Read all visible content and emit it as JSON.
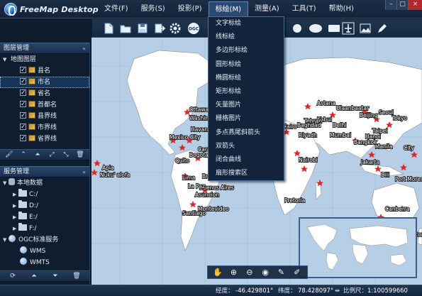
{
  "app": {
    "title": "FreeMap Desktop"
  },
  "menubar": {
    "items": [
      {
        "label": "文件(F)"
      },
      {
        "label": "服务(S)"
      },
      {
        "label": "投影(P)"
      },
      {
        "label": "标绘(M)"
      },
      {
        "label": "测量(A)"
      },
      {
        "label": "工具(T)"
      },
      {
        "label": "帮助(H)"
      }
    ],
    "active_index": 3
  },
  "window_controls": {
    "minimize": "–",
    "maximize": "□",
    "close": "×"
  },
  "toolbar": {
    "icons": [
      "new-file-icon",
      "open-folder-icon",
      "save-icon",
      "export-icon",
      "settings-icon",
      "ogc-icon",
      "circle-icon",
      "ellipse-icon",
      "rectangle-icon",
      "plane-icon",
      "chart-image-icon",
      "pen-icon"
    ],
    "ogc_label": "OGC"
  },
  "plot_menu": {
    "items": [
      "文字标绘",
      "线标绘",
      "多边形标绘",
      "圆形标绘",
      "椭圆标绘",
      "矩形标绘",
      "矢量图片",
      "栅格图片",
      "多点燕尾斜箭头",
      "双箭头",
      "闭合曲线",
      "扇形搜索区"
    ]
  },
  "layer_panel": {
    "title": "图层管理",
    "pin": "«",
    "root_label": "地图图层",
    "layers": [
      {
        "label": "县名",
        "checked": true,
        "selected": false
      },
      {
        "label": "市名",
        "checked": true,
        "selected": true
      },
      {
        "label": "省名",
        "checked": true,
        "selected": false
      },
      {
        "label": "首都名",
        "checked": true,
        "selected": false
      },
      {
        "label": "县界线",
        "checked": true,
        "selected": false
      },
      {
        "label": "市界线",
        "checked": true,
        "selected": false
      },
      {
        "label": "省界线",
        "checked": true,
        "selected": false
      }
    ],
    "toolbar_icons": [
      "paint-icon",
      "move-up-icon",
      "double-up-icon",
      "double-down-icon",
      "move-down-icon",
      "delete-icon"
    ]
  },
  "service_panel": {
    "title": "服务管理",
    "pin": "«",
    "local_root": "本地数据",
    "drives": [
      "C:/",
      "D:/",
      "E:/",
      "F:/"
    ],
    "ogc_root": "OGC标准服务",
    "ogc_services": [
      "WMS",
      "WMTS"
    ],
    "toolbar_icons": [
      "refresh-icon",
      "double-up-icon",
      "double-down-icon",
      "delete-icon"
    ]
  },
  "map": {
    "colors": {
      "ocean": "#b7cfe6",
      "land": "#ffffff",
      "border": "#6f6f6f",
      "marker": "#e52222"
    },
    "labels": [
      "Ottawa",
      "Washington",
      "Mexico City",
      "Havana",
      "Lima",
      "Santiago",
      "Apia",
      "Nuku' alofa",
      "Buenos Aires",
      "Ulaanbaatar",
      "Astana",
      "Beijing",
      "Tokyo",
      "Seoul",
      "Taipei",
      "Manila",
      "Jakarta",
      "Canberra",
      "Wellington",
      "Mumbai",
      "Delhi",
      "Bangkok",
      "Hanoi",
      "Kabul",
      "Tehran",
      "Baghdad",
      "Riyadh",
      "Cairo",
      "Nairobi",
      "Pretoria",
      "Port Moresby",
      "Dili",
      "Brasilia",
      "Bogota",
      "Caracas",
      "Quito",
      "La Paz",
      "Montevideo",
      "Asuncion",
      "City"
    ]
  },
  "map_nav": {
    "icons": [
      "pan-hand-icon",
      "zoom-in-icon",
      "zoom-out-icon",
      "full-extent-icon",
      "edit-icon",
      "edit-alt-icon"
    ]
  },
  "statusbar": {
    "lon_label": "经度：",
    "lon_value": "-46.429801°",
    "lat_label": "纬度：",
    "lat_value": "78.428097°",
    "scale_label": "比例尺：",
    "scale_value": "1:100599660"
  }
}
